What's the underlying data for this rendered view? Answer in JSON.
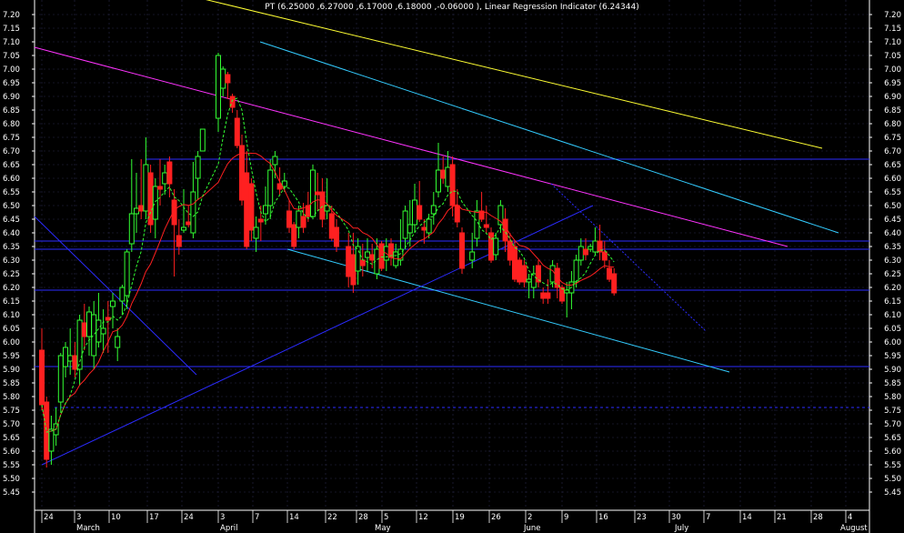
{
  "chart_data": {
    "type": "candlestick",
    "title": "PT (6.25000 ,6.27000 ,6.17000 ,6.18000 ,-0.06000 ), Linear Regression Indicator (6.24344)",
    "ylim": [
      5.42,
      7.24
    ],
    "y_ticks": [
      "7.20",
      "7.15",
      "7.10",
      "7.05",
      "7.00",
      "6.95",
      "6.90",
      "6.85",
      "6.80",
      "6.75",
      "6.70",
      "6.65",
      "6.60",
      "6.55",
      "6.50",
      "6.45",
      "6.40",
      "6.35",
      "6.30",
      "6.25",
      "6.20",
      "6.15",
      "6.10",
      "6.05",
      "6.00",
      "5.95",
      "5.90",
      "5.85",
      "5.80",
      "5.75",
      "5.70",
      "5.65",
      "5.60",
      "5.55",
      "5.50",
      "5.45"
    ],
    "x_day_labels": [
      "24",
      "3",
      "10",
      "17",
      "24",
      "3",
      "7",
      "14",
      "22",
      "28",
      "5",
      "12",
      "19",
      "26",
      "2",
      "9",
      "16",
      "23",
      "30",
      "7",
      "14",
      "21",
      "28",
      "4"
    ],
    "x_month_labels": [
      "March",
      "April",
      "May",
      "June",
      "July",
      "August"
    ],
    "last_close": 6.18,
    "change": -0.06,
    "linear_regression_value": 6.24344,
    "grid": true,
    "colors": {
      "background": "#000000",
      "up": "#33ff33",
      "down": "#ff2020",
      "ma_red": "#ff2020",
      "ma_green": "#33ff33",
      "horizontal_lines": "#2b2bff",
      "magenta_line": "#ff33ff",
      "cyan_lines": "#33ccff",
      "yellow_line": "#ffff33",
      "text": "#ffffff"
    },
    "horizontal_levels": [
      6.67,
      6.37,
      6.34,
      6.19,
      5.91
    ],
    "dashed_horizontal_level": 5.76,
    "candles": [
      {
        "o": 5.97,
        "h": 6.05,
        "l": 5.75,
        "c": 5.77
      },
      {
        "o": 5.78,
        "h": 5.8,
        "l": 5.54,
        "c": 5.57
      },
      {
        "o": 5.6,
        "h": 5.73,
        "l": 5.55,
        "c": 5.68
      },
      {
        "o": 5.66,
        "h": 5.76,
        "l": 5.62,
        "c": 5.7
      },
      {
        "o": 5.78,
        "h": 5.96,
        "l": 5.74,
        "c": 5.95
      },
      {
        "o": 5.91,
        "h": 6.0,
        "l": 5.87,
        "c": 5.98
      },
      {
        "o": 5.93,
        "h": 6.05,
        "l": 5.88,
        "c": 5.95
      },
      {
        "o": 5.95,
        "h": 6.0,
        "l": 5.87,
        "c": 5.9
      },
      {
        "o": 5.9,
        "h": 6.1,
        "l": 5.84,
        "c": 6.08
      },
      {
        "o": 6.07,
        "h": 6.14,
        "l": 5.97,
        "c": 6.02
      },
      {
        "o": 6.02,
        "h": 6.13,
        "l": 5.95,
        "c": 6.11
      },
      {
        "o": 5.95,
        "h": 6.15,
        "l": 5.9,
        "c": 6.1
      },
      {
        "o": 6.0,
        "h": 6.18,
        "l": 5.98,
        "c": 6.08
      },
      {
        "o": 6.03,
        "h": 6.12,
        "l": 5.96,
        "c": 6.05
      },
      {
        "o": 6.09,
        "h": 6.15,
        "l": 5.96,
        "c": 6.08
      },
      {
        "o": 6.13,
        "h": 6.18,
        "l": 6.05,
        "c": 6.15
      },
      {
        "o": 5.98,
        "h": 6.05,
        "l": 5.93,
        "c": 6.02
      },
      {
        "o": 6.15,
        "h": 6.21,
        "l": 6.1,
        "c": 6.2
      },
      {
        "o": 6.17,
        "h": 6.34,
        "l": 6.12,
        "c": 6.33
      },
      {
        "o": 6.36,
        "h": 6.67,
        "l": 6.33,
        "c": 6.47
      },
      {
        "o": 6.47,
        "h": 6.62,
        "l": 6.4,
        "c": 6.49
      },
      {
        "o": 6.5,
        "h": 6.67,
        "l": 6.45,
        "c": 6.48
      },
      {
        "o": 6.48,
        "h": 6.75,
        "l": 6.45,
        "c": 6.65
      },
      {
        "o": 6.62,
        "h": 6.65,
        "l": 6.4,
        "c": 6.43
      },
      {
        "o": 6.45,
        "h": 6.6,
        "l": 6.38,
        "c": 6.57
      },
      {
        "o": 6.57,
        "h": 6.67,
        "l": 6.5,
        "c": 6.56
      },
      {
        "o": 6.58,
        "h": 6.65,
        "l": 6.54,
        "c": 6.62
      },
      {
        "o": 6.66,
        "h": 6.68,
        "l": 6.53,
        "c": 6.58
      },
      {
        "o": 6.52,
        "h": 6.56,
        "l": 6.24,
        "c": 6.43
      },
      {
        "o": 6.39,
        "h": 6.45,
        "l": 6.32,
        "c": 6.35
      },
      {
        "o": 6.41,
        "h": 6.56,
        "l": 6.4,
        "c": 6.42
      },
      {
        "o": 6.44,
        "h": 6.5,
        "l": 6.42,
        "c": 6.43
      },
      {
        "o": 6.4,
        "h": 6.66,
        "l": 6.38,
        "c": 6.55
      },
      {
        "o": 6.6,
        "h": 6.7,
        "l": 6.52,
        "c": 6.68
      },
      {
        "o": 6.7,
        "h": 6.75,
        "l": 6.76,
        "c": 6.78
      },
      {
        "o": 6.82,
        "h": 7.06,
        "l": 6.77,
        "c": 7.05
      },
      {
        "o": 6.93,
        "h": 7.01,
        "l": 6.9,
        "c": 7.0
      },
      {
        "o": 6.98,
        "h": 6.99,
        "l": 6.89,
        "c": 6.95
      },
      {
        "o": 6.9,
        "h": 6.91,
        "l": 6.84,
        "c": 6.86
      },
      {
        "o": 6.82,
        "h": 6.85,
        "l": 6.71,
        "c": 6.72
      },
      {
        "o": 6.72,
        "h": 6.76,
        "l": 6.5,
        "c": 6.52
      },
      {
        "o": 6.62,
        "h": 6.7,
        "l": 6.34,
        "c": 6.35
      },
      {
        "o": 6.58,
        "h": 6.6,
        "l": 6.37,
        "c": 6.41
      },
      {
        "o": 6.38,
        "h": 6.46,
        "l": 6.33,
        "c": 6.42
      },
      {
        "o": 6.45,
        "h": 6.5,
        "l": 6.37,
        "c": 6.44
      },
      {
        "o": 6.47,
        "h": 6.57,
        "l": 6.43,
        "c": 6.5
      },
      {
        "o": 6.5,
        "h": 6.67,
        "l": 6.45,
        "c": 6.63
      },
      {
        "o": 6.65,
        "h": 6.7,
        "l": 6.6,
        "c": 6.68
      },
      {
        "o": 6.58,
        "h": 6.64,
        "l": 6.54,
        "c": 6.56
      },
      {
        "o": 6.57,
        "h": 6.62,
        "l": 6.55,
        "c": 6.59
      },
      {
        "o": 6.48,
        "h": 6.52,
        "l": 6.4,
        "c": 6.42
      },
      {
        "o": 6.43,
        "h": 6.44,
        "l": 6.34,
        "c": 6.35
      },
      {
        "o": 6.42,
        "h": 6.5,
        "l": 6.38,
        "c": 6.48
      },
      {
        "o": 6.46,
        "h": 6.51,
        "l": 6.4,
        "c": 6.42
      },
      {
        "o": 6.5,
        "h": 6.55,
        "l": 6.44,
        "c": 6.46
      },
      {
        "o": 6.46,
        "h": 6.65,
        "l": 6.45,
        "c": 6.63
      },
      {
        "o": 6.55,
        "h": 6.62,
        "l": 6.48,
        "c": 6.54
      },
      {
        "o": 6.55,
        "h": 6.6,
        "l": 6.42,
        "c": 6.45
      },
      {
        "o": 6.48,
        "h": 6.6,
        "l": 6.45,
        "c": 6.5
      },
      {
        "o": 6.47,
        "h": 6.5,
        "l": 6.37,
        "c": 6.38
      },
      {
        "o": 6.42,
        "h": 6.45,
        "l": 6.33,
        "c": 6.35
      },
      {
        "o": 6.35,
        "h": 6.4,
        "l": 6.2,
        "c": 6.24
      },
      {
        "o": 6.32,
        "h": 6.4,
        "l": 6.18,
        "c": 6.21
      },
      {
        "o": 6.26,
        "h": 6.38,
        "l": 6.21,
        "c": 6.35
      },
      {
        "o": 6.3,
        "h": 6.36,
        "l": 6.24,
        "c": 6.28
      },
      {
        "o": 6.31,
        "h": 6.38,
        "l": 6.26,
        "c": 6.33
      },
      {
        "o": 6.32,
        "h": 6.36,
        "l": 6.27,
        "c": 6.3
      },
      {
        "o": 6.25,
        "h": 6.38,
        "l": 6.23,
        "c": 6.34
      },
      {
        "o": 6.36,
        "h": 6.37,
        "l": 6.26,
        "c": 6.27
      },
      {
        "o": 6.3,
        "h": 6.38,
        "l": 6.26,
        "c": 6.35
      },
      {
        "o": 6.36,
        "h": 6.38,
        "l": 6.28,
        "c": 6.31
      },
      {
        "o": 6.28,
        "h": 6.36,
        "l": 6.27,
        "c": 6.33
      },
      {
        "o": 6.3,
        "h": 6.45,
        "l": 6.28,
        "c": 6.34
      },
      {
        "o": 6.38,
        "h": 6.5,
        "l": 6.34,
        "c": 6.48
      },
      {
        "o": 6.4,
        "h": 6.52,
        "l": 6.35,
        "c": 6.43
      },
      {
        "o": 6.43,
        "h": 6.58,
        "l": 6.4,
        "c": 6.52
      },
      {
        "o": 6.5,
        "h": 6.59,
        "l": 6.44,
        "c": 6.45
      },
      {
        "o": 6.42,
        "h": 6.45,
        "l": 6.36,
        "c": 6.41
      },
      {
        "o": 6.4,
        "h": 6.47,
        "l": 6.38,
        "c": 6.45
      },
      {
        "o": 6.47,
        "h": 6.55,
        "l": 6.43,
        "c": 6.5
      },
      {
        "o": 6.55,
        "h": 6.73,
        "l": 6.53,
        "c": 6.63
      },
      {
        "o": 6.63,
        "h": 6.68,
        "l": 6.58,
        "c": 6.6
      },
      {
        "o": 6.57,
        "h": 6.7,
        "l": 6.55,
        "c": 6.64
      },
      {
        "o": 6.65,
        "h": 6.68,
        "l": 6.46,
        "c": 6.5
      },
      {
        "o": 6.5,
        "h": 6.56,
        "l": 6.42,
        "c": 6.44
      },
      {
        "o": 6.4,
        "h": 6.42,
        "l": 6.25,
        "c": 6.27
      },
      {
        "o": 6.3,
        "h": 6.4,
        "l": 6.27,
        "c": 6.33
      },
      {
        "o": 6.38,
        "h": 6.52,
        "l": 6.35,
        "c": 6.48
      },
      {
        "o": 6.48,
        "h": 6.55,
        "l": 6.44,
        "c": 6.45
      },
      {
        "o": 6.43,
        "h": 6.5,
        "l": 6.4,
        "c": 6.42
      },
      {
        "o": 6.4,
        "h": 6.42,
        "l": 6.29,
        "c": 6.3
      },
      {
        "o": 6.32,
        "h": 6.4,
        "l": 6.3,
        "c": 6.38
      },
      {
        "o": 6.43,
        "h": 6.52,
        "l": 6.4,
        "c": 6.5
      },
      {
        "o": 6.45,
        "h": 6.49,
        "l": 6.33,
        "c": 6.37
      },
      {
        "o": 6.37,
        "h": 6.4,
        "l": 6.28,
        "c": 6.3
      },
      {
        "o": 6.35,
        "h": 6.37,
        "l": 6.22,
        "c": 6.23
      },
      {
        "o": 6.3,
        "h": 6.31,
        "l": 6.21,
        "c": 6.22
      },
      {
        "o": 6.28,
        "h": 6.3,
        "l": 6.2,
        "c": 6.22
      },
      {
        "o": 6.22,
        "h": 6.25,
        "l": 6.16,
        "c": 6.23
      },
      {
        "o": 6.2,
        "h": 6.28,
        "l": 6.16,
        "c": 6.25
      },
      {
        "o": 6.28,
        "h": 6.3,
        "l": 6.2,
        "c": 6.22
      },
      {
        "o": 6.18,
        "h": 6.2,
        "l": 6.14,
        "c": 6.16
      },
      {
        "o": 6.18,
        "h": 6.23,
        "l": 6.14,
        "c": 6.16
      },
      {
        "o": 6.22,
        "h": 6.3,
        "l": 6.2,
        "c": 6.28
      },
      {
        "o": 6.27,
        "h": 6.29,
        "l": 6.16,
        "c": 6.2
      },
      {
        "o": 6.2,
        "h": 6.21,
        "l": 6.14,
        "c": 6.15
      },
      {
        "o": 6.18,
        "h": 6.22,
        "l": 6.09,
        "c": 6.19
      },
      {
        "o": 6.18,
        "h": 6.26,
        "l": 6.12,
        "c": 6.22
      },
      {
        "o": 6.22,
        "h": 6.32,
        "l": 6.2,
        "c": 6.3
      },
      {
        "o": 6.3,
        "h": 6.38,
        "l": 6.28,
        "c": 6.35
      },
      {
        "o": 6.34,
        "h": 6.38,
        "l": 6.3,
        "c": 6.32
      },
      {
        "o": 6.34,
        "h": 6.36,
        "l": 6.33,
        "c": 6.35
      },
      {
        "o": 6.33,
        "h": 6.42,
        "l": 6.32,
        "c": 6.37
      },
      {
        "o": 6.37,
        "h": 6.43,
        "l": 6.3,
        "c": 6.33
      },
      {
        "o": 6.33,
        "h": 6.37,
        "l": 6.27,
        "c": 6.3
      },
      {
        "o": 6.27,
        "h": 6.3,
        "l": 6.22,
        "c": 6.23
      },
      {
        "o": 6.25,
        "h": 6.27,
        "l": 6.17,
        "c": 6.18
      }
    ]
  }
}
